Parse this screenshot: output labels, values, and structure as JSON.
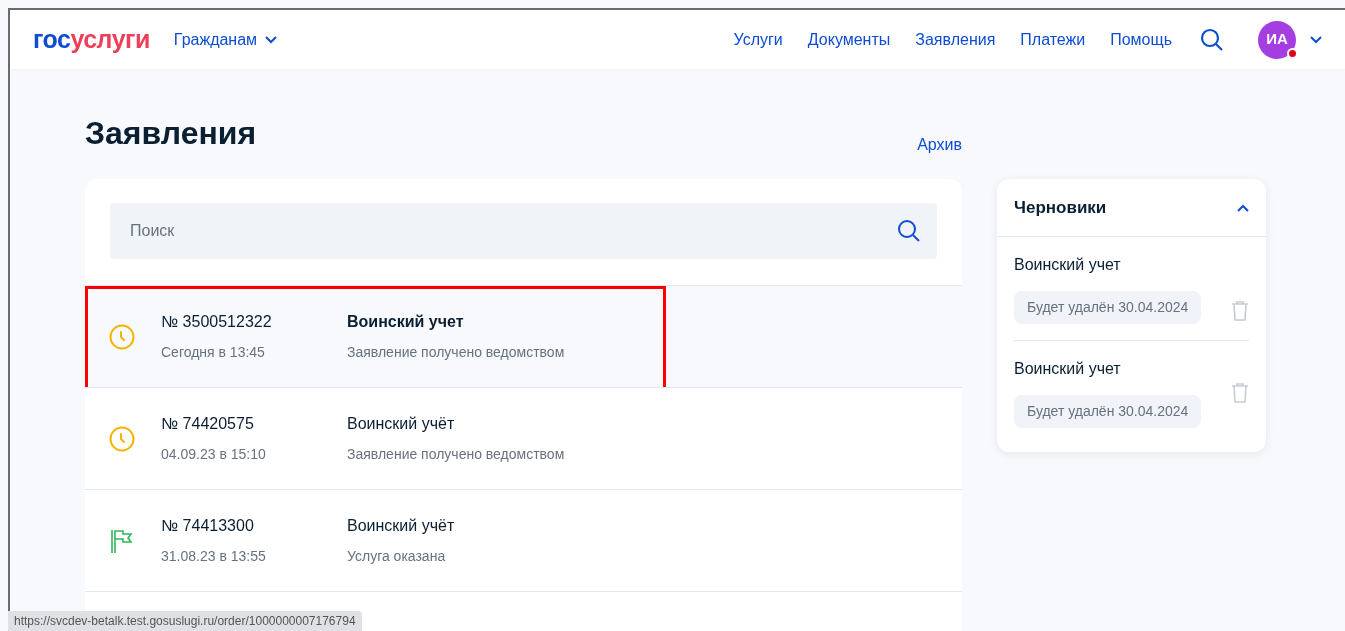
{
  "header": {
    "logo": {
      "part1": "гос",
      "part2": "услуги"
    },
    "audience_menu": "Гражданам",
    "nav": [
      {
        "label": "Услуги",
        "selected": false
      },
      {
        "label": "Документы",
        "selected": false
      },
      {
        "label": "Заявления",
        "selected": false
      },
      {
        "label": "Платежи",
        "selected": false
      },
      {
        "label": "Помощь",
        "selected": false
      }
    ],
    "avatar": {
      "initials": "ИА",
      "notification": true
    }
  },
  "page": {
    "title": "Заявления",
    "archive_link": "Архив"
  },
  "search": {
    "placeholder": "Поиск"
  },
  "applications": [
    {
      "number": "№ 3500512322",
      "date": "Сегодня в 13:45",
      "service": "Воинский учет",
      "status": "Заявление получено ведомством",
      "kind": "pending",
      "unread": true,
      "highlighted": true
    },
    {
      "number": "№ 74420575",
      "date": "04.09.23 в 15:10",
      "service": "Воинский учёт",
      "status": "Заявление получено ведомством",
      "kind": "pending",
      "unread": false,
      "highlighted": false
    },
    {
      "number": "№ 74413300",
      "date": "31.08.23 в 13:55",
      "service": "Воинский учёт",
      "status": "Услуга оказана",
      "kind": "done",
      "unread": false,
      "highlighted": false
    }
  ],
  "drafts": {
    "title": "Черновики",
    "expanded": true,
    "items": [
      {
        "name": "Воинский учет",
        "expiry": "Будет удалён 30.04.2024"
      },
      {
        "name": "Воинский учет",
        "expiry": "Будет удалён 30.04.2024"
      }
    ]
  },
  "status_bar": {
    "url": "https://svcdev-betalk.test.gosuslugi.ru/order/1000000007176794"
  }
}
